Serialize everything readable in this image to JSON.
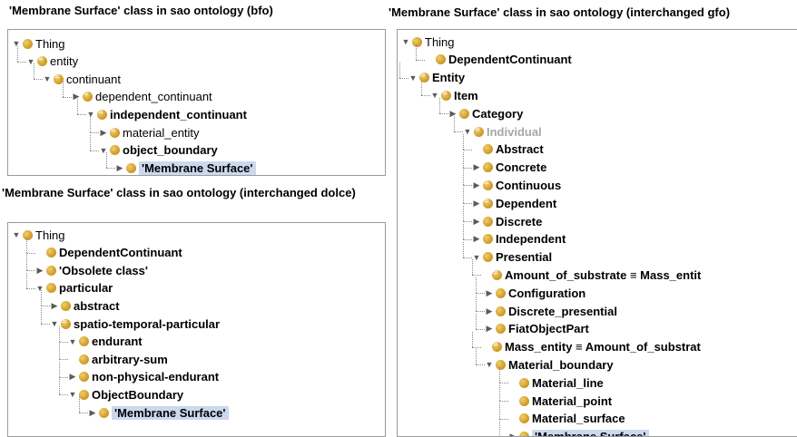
{
  "panels": [
    {
      "caption": "'Membrane Surface' class in sao ontology (bfo)",
      "rows": [
        {
          "label": "Thing",
          "toggle": "open",
          "eq": false,
          "bold": false
        },
        {
          "label": "entity",
          "toggle": "open",
          "eq": true,
          "bold": false
        },
        {
          "label": "continuant",
          "toggle": "open",
          "eq": true,
          "bold": false
        },
        {
          "label": "dependent_continuant",
          "toggle": "closed",
          "eq": true,
          "bold": false
        },
        {
          "label": "independent_continuant",
          "toggle": "open",
          "eq": true,
          "bold": true
        },
        {
          "label": "material_entity",
          "toggle": "closed",
          "eq": true,
          "bold": false
        },
        {
          "label": "object_boundary",
          "toggle": "open",
          "eq": false,
          "bold": true
        },
        {
          "label": "'Membrane Surface'",
          "toggle": "closed",
          "eq": false,
          "bold": true,
          "selected": true
        }
      ]
    },
    {
      "caption": "'Membrane Surface' class in sao ontology (interchanged dolce)",
      "rows": [
        {
          "label": "Thing",
          "toggle": "open",
          "eq": false,
          "bold": false
        },
        {
          "label": "DependentContinuant",
          "toggle": "none",
          "eq": false,
          "bold": true
        },
        {
          "label": "'Obsolete class'",
          "toggle": "closed",
          "eq": false,
          "bold": true
        },
        {
          "label": "particular",
          "toggle": "open",
          "eq": false,
          "bold": true
        },
        {
          "label": "abstract",
          "toggle": "closed",
          "eq": false,
          "bold": true
        },
        {
          "label": "spatio-temporal-particular",
          "toggle": "open",
          "eq": true,
          "bold": true
        },
        {
          "label": "endurant",
          "toggle": "open",
          "eq": false,
          "bold": true
        },
        {
          "label": "arbitrary-sum",
          "toggle": "none",
          "eq": false,
          "bold": true
        },
        {
          "label": "non-physical-endurant",
          "toggle": "closed",
          "eq": false,
          "bold": true
        },
        {
          "label": "ObjectBoundary",
          "toggle": "open",
          "eq": false,
          "bold": true
        },
        {
          "label": "'Membrane Surface'",
          "toggle": "closed",
          "eq": false,
          "bold": true,
          "selected": true
        }
      ]
    },
    {
      "caption": "'Membrane Surface' class in sao ontology (interchanged gfo)",
      "rows": [
        {
          "label": "Thing",
          "toggle": "open",
          "eq": false,
          "bold": false
        },
        {
          "label": "DependentContinuant",
          "toggle": "none",
          "eq": false,
          "bold": true
        },
        {
          "label": "Entity",
          "toggle": "open",
          "eq": true,
          "bold": true
        },
        {
          "label": "Item",
          "toggle": "open",
          "eq": true,
          "bold": true
        },
        {
          "label": "Category",
          "toggle": "closed",
          "eq": false,
          "bold": true
        },
        {
          "label": "Individual",
          "toggle": "open",
          "eq": true,
          "bold": true,
          "gray": true
        },
        {
          "label": "Abstract",
          "toggle": "none",
          "eq": false,
          "bold": true
        },
        {
          "label": "Concrete",
          "toggle": "closed",
          "eq": false,
          "bold": true
        },
        {
          "label": "Continuous",
          "toggle": "closed",
          "eq": true,
          "bold": true
        },
        {
          "label": "Dependent",
          "toggle": "closed",
          "eq": true,
          "bold": true
        },
        {
          "label": "Discrete",
          "toggle": "closed",
          "eq": false,
          "bold": true
        },
        {
          "label": "Independent",
          "toggle": "closed",
          "eq": false,
          "bold": true
        },
        {
          "label": "Presential",
          "toggle": "open",
          "eq": false,
          "bold": true
        },
        {
          "label": "Amount_of_substrate ≡ Mass_entit",
          "toggle": "none",
          "eq": true,
          "bold": true
        },
        {
          "label": "Configuration",
          "toggle": "closed",
          "eq": false,
          "bold": true
        },
        {
          "label": "Discrete_presential",
          "toggle": "closed",
          "eq": false,
          "bold": true
        },
        {
          "label": "FiatObjectPart",
          "toggle": "closed",
          "eq": false,
          "bold": true
        },
        {
          "label": "Mass_entity ≡ Amount_of_substrat",
          "toggle": "none",
          "eq": true,
          "bold": true
        },
        {
          "label": "Material_boundary",
          "toggle": "open",
          "eq": false,
          "bold": true
        },
        {
          "label": "Material_line",
          "toggle": "none",
          "eq": false,
          "bold": true
        },
        {
          "label": "Material_point",
          "toggle": "none",
          "eq": false,
          "bold": true
        },
        {
          "label": "Material_surface",
          "toggle": "none",
          "eq": false,
          "bold": true
        },
        {
          "label": "'Membrane Surface'",
          "toggle": "closed",
          "eq": false,
          "bold": true,
          "selected": true
        }
      ]
    }
  ]
}
